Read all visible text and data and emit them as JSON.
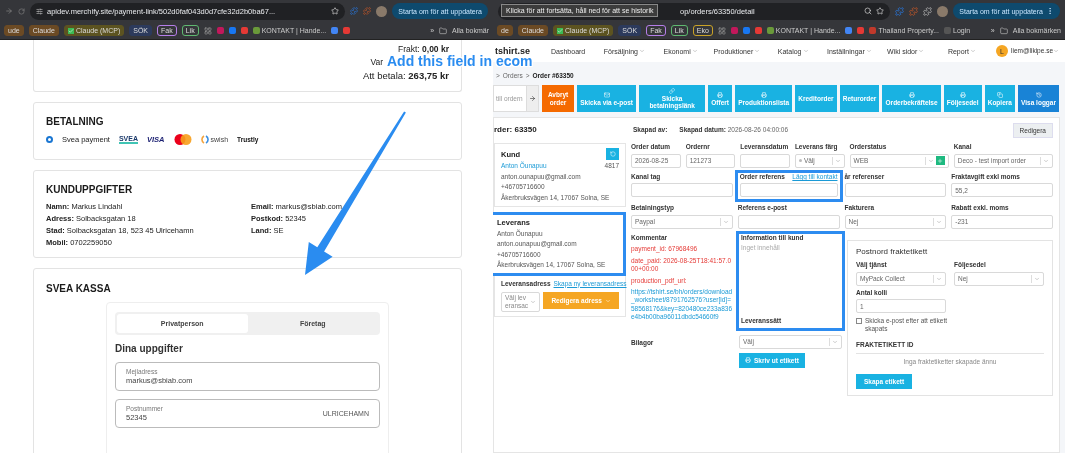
{
  "left_window": {
    "browser": {
      "url": "apidev.merchify.site/payment-link/502d0faf043d0d7cfe32d2b0ba67...",
      "update_button": "Starta om för att uppdatera",
      "bookmarks": [
        {
          "kind": "chip",
          "label": "ude",
          "color": "#6b4a24"
        },
        {
          "kind": "chip",
          "label": "Claude",
          "color": "#6b4a24"
        },
        {
          "kind": "check",
          "label": "Claude (MCP)",
          "color": "#5c5320"
        },
        {
          "kind": "chip",
          "label": "SÖK",
          "color": "#2c3a5c"
        },
        {
          "kind": "outline",
          "label": "Fak",
          "color": "#b57ee8"
        },
        {
          "kind": "outline",
          "label": "Lik",
          "color": "#5fb870"
        },
        {
          "kind": "grid"
        },
        {
          "kind": "favicon",
          "color": "#c2185b"
        },
        {
          "kind": "favicon",
          "color": "#1877f2"
        },
        {
          "kind": "favicon",
          "color": "#e53935"
        },
        {
          "kind": "favicon",
          "label": "KONTAKT | Hande...",
          "color": "#6a9a3a"
        },
        {
          "kind": "favicon",
          "color": "#4285f4"
        },
        {
          "kind": "favicon",
          "color": "#e53935"
        }
      ],
      "overflow": "»",
      "all_bookmarks": "Alla bokmär"
    },
    "summary": [
      {
        "kind": "line",
        "label": "Frakt:",
        "value": "0,00 kr"
      },
      {
        "kind": "cut",
        "label": "Var"
      },
      {
        "kind": "total",
        "label": "Att betala:",
        "value": "263,75 kr"
      }
    ],
    "payment": {
      "title": "BETALNING",
      "option": {
        "label": "Svea payment",
        "selected": true
      },
      "logos": [
        {
          "kind": "svea",
          "label": "SVEA"
        },
        {
          "kind": "visa",
          "label": "VISA"
        },
        {
          "kind": "mastercard"
        },
        {
          "kind": "swish",
          "label": "swish"
        },
        {
          "kind": "trustly",
          "label": "Trustly"
        }
      ]
    },
    "customer": {
      "title": "KUNDUPPGIFTER",
      "columns": [
        [
          {
            "label": "Namn:",
            "value": "Markus Lindahl"
          },
          {
            "label": "Adress:",
            "value": "Solbacksgatan 18"
          },
          {
            "label": "Stad:",
            "value": "Solbacksgatan 18, 523 45 Ulricehamn"
          },
          {
            "label": "Mobil:",
            "value": "0702259050"
          }
        ],
        [
          {
            "label": "Email:",
            "value": "markus@sbiab.com"
          },
          {
            "label": "Postkod:",
            "value": "52345"
          },
          {
            "label": "Land:",
            "value": "SE"
          }
        ]
      ]
    },
    "checkout": {
      "title": "SVEA KASSA",
      "tabs": [
        {
          "label": "Privatperson",
          "selected": true
        },
        {
          "label": "Företag",
          "selected": false
        }
      ],
      "heading": "Dina uppgifter",
      "fields": [
        {
          "label": "Mejladress",
          "value": "markus@sbiab.com"
        },
        {
          "label": "Postnummer",
          "value": "52345",
          "suffix": "ULRICEHAMN"
        }
      ]
    }
  },
  "right_window": {
    "browser": {
      "url": "op/orders/63350/detail",
      "tooltip": "Klicka för att fortsätta, håll ned för att se historik",
      "update_button": "Starta om för att uppdatera",
      "bookmarks": [
        {
          "kind": "chip",
          "label": "de",
          "color": "#6b4a24"
        },
        {
          "kind": "chip",
          "label": "Claude",
          "color": "#6b4a24"
        },
        {
          "kind": "check",
          "label": "Claude (MCP)",
          "color": "#5c5320"
        },
        {
          "kind": "chip",
          "label": "SÖK",
          "color": "#2c3a5c"
        },
        {
          "kind": "outline",
          "label": "Fak",
          "color": "#b57ee8"
        },
        {
          "kind": "outline",
          "label": "Lik",
          "color": "#5fb870"
        },
        {
          "kind": "outline",
          "label": "Eko",
          "color": "#c9a227"
        },
        {
          "kind": "grid"
        },
        {
          "kind": "favicon",
          "color": "#c2185b"
        },
        {
          "kind": "favicon",
          "color": "#1877f2"
        },
        {
          "kind": "favicon",
          "color": "#e53935"
        },
        {
          "kind": "favicon",
          "label": "KONTAKT | Hande...",
          "color": "#6a9a3a"
        },
        {
          "kind": "favicon",
          "color": "#4285f4"
        },
        {
          "kind": "favicon",
          "color": "#e53935"
        },
        {
          "kind": "favicon",
          "label": "Thailand Property...",
          "color": "#c0392b"
        },
        {
          "kind": "favicon",
          "label": "Login",
          "color": "#555555"
        }
      ],
      "overflow": "»",
      "all_bookmarks": "Alla bokmärken"
    },
    "nav": {
      "logo": "tshirt.se",
      "items": [
        {
          "label": "Dashboard",
          "dropdown": false
        },
        {
          "label": "Försäljning",
          "dropdown": true
        },
        {
          "label": "Ekonomi",
          "dropdown": true
        },
        {
          "label": "Produktioner",
          "dropdown": true
        },
        {
          "label": "Katalog",
          "dropdown": true
        },
        {
          "label": "Inställningar",
          "dropdown": true
        },
        {
          "label": "Wiki sidor",
          "dropdown": true
        },
        {
          "label": "Report",
          "dropdown": true
        }
      ],
      "user": {
        "initial": "L",
        "email": "liem@likipe.se"
      }
    },
    "breadcrumb": {
      "separator": ">",
      "items": [
        "Orders",
        "Order #63350"
      ]
    },
    "toolbar": {
      "search_placeholder": "till ordern",
      "buttons": [
        {
          "label": "Avbryt order",
          "kind": "cancel"
        },
        {
          "label": "Skicka via e-post",
          "kind": "email"
        },
        {
          "label": "Skicka betalningslänk",
          "kind": "payment-link"
        },
        {
          "label": "Offert",
          "kind": "print"
        },
        {
          "label": "Produktionslista",
          "kind": "print"
        },
        {
          "label": "Kreditorder",
          "kind": "plain"
        },
        {
          "label": "Returorder",
          "kind": "plain"
        },
        {
          "label": "Orderbekräftelse",
          "kind": "print"
        },
        {
          "label": "Följesedel",
          "kind": "print"
        },
        {
          "label": "Kopiera",
          "kind": "copy"
        },
        {
          "label": "Visa loggar",
          "kind": "logs"
        }
      ]
    },
    "order": {
      "title": "rder: 63350",
      "created_by": "Skapad av:",
      "created_date_label": "Skapad datum:",
      "created_date": "2026-08-26 04:00:06",
      "edit_button": "Redigera"
    },
    "customer_card": {
      "title": "Kund",
      "name": "Anton Õunapuu",
      "number": "4817",
      "lines": [
        "anton.ounapuu@gmail.com",
        "+46705716600",
        "Åkerbruksvägen 14, 17067 Solna, SE"
      ]
    },
    "delivery_card": {
      "title": "Leverans",
      "highlighted": true,
      "lines": [
        "Anton Õunapuu",
        "anton.ounapuu@gmail.com",
        "+46705716600",
        "Åkerbruksvägen 14, 17067 Solna, SE"
      ]
    },
    "delivery_address": {
      "label": "Leveransadress",
      "link": "Skapa ny leveransadress",
      "select": "Välj leveransac",
      "button": "Redigera adress"
    },
    "form_rows": [
      [
        {
          "kind": "input",
          "label": "Order datum",
          "value": "2026-08-25"
        },
        {
          "kind": "input",
          "label": "Ordernr",
          "value": "121273"
        },
        {
          "kind": "input",
          "label": "Leveransdatum"
        },
        {
          "kind": "select",
          "label": "Leverans färg",
          "value": "Välj",
          "dot": true
        },
        {
          "kind": "select",
          "label": "Orderstatus",
          "value": "WEB",
          "add": true
        },
        {
          "kind": "select",
          "label": "Kanal",
          "value": "Deco - test import order"
        }
      ],
      [
        {
          "kind": "input",
          "label": "Kanal tag"
        },
        {
          "kind": "input",
          "label": "Order referens",
          "link": "Lägg till kontakt",
          "highlighted": true
        },
        {
          "kind": "input",
          "label": "år referenser"
        },
        {
          "kind": "input",
          "label": "Fraktavgift exkl moms",
          "value": "55,2"
        }
      ],
      [
        {
          "kind": "select",
          "label": "Betalningstyp",
          "value": "Paypal"
        },
        {
          "kind": "input",
          "label": "Referens e-post"
        },
        {
          "kind": "select",
          "label": "Fakturera",
          "value": "Nej"
        },
        {
          "kind": "input",
          "label": "Rabatt exkl. moms",
          "value": "-231"
        }
      ]
    ],
    "comment": {
      "label": "Kommentar",
      "lines": [
        {
          "kind": "note",
          "text": "payment_id: 67968496"
        },
        {
          "kind": "note",
          "text": "date_paid: 2026-08-25T18:41:57.000+00:00"
        },
        {
          "kind": "note",
          "text": "production_pdf_url:"
        },
        {
          "kind": "link",
          "text": "https://tshirt.se/bh/orders/download_worksheet/8791762576?user[id]=58568176&key=820480ce233a836e4b4b00ba96011dbdc54660f9"
        }
      ],
      "attachments_label": "Bilagor"
    },
    "customer_info": {
      "label": "Information till kund",
      "placeholder": "Inget innehåll",
      "highlighted": true
    },
    "shipping": {
      "label": "Leveranssätt",
      "select": "Välj",
      "button": "Skriv ut etikett"
    },
    "postnord": {
      "title": "Postnord fraktetikett",
      "service_label": "Välj tjänst",
      "service": "MyPack Collect",
      "slip_label": "Följesedel",
      "slip": "Nej",
      "parcels_label": "Antal kolli",
      "parcels": "1",
      "email_option": {
        "label": "Skicka e-post efter att etikett skapats",
        "checked": false
      },
      "id_heading": "FRAKTETIKETT ID",
      "empty": "Inga fraktetiketter skapade ännu",
      "button": "Skapa etikett"
    }
  },
  "annotation": {
    "text": "Add this field in ecom"
  }
}
